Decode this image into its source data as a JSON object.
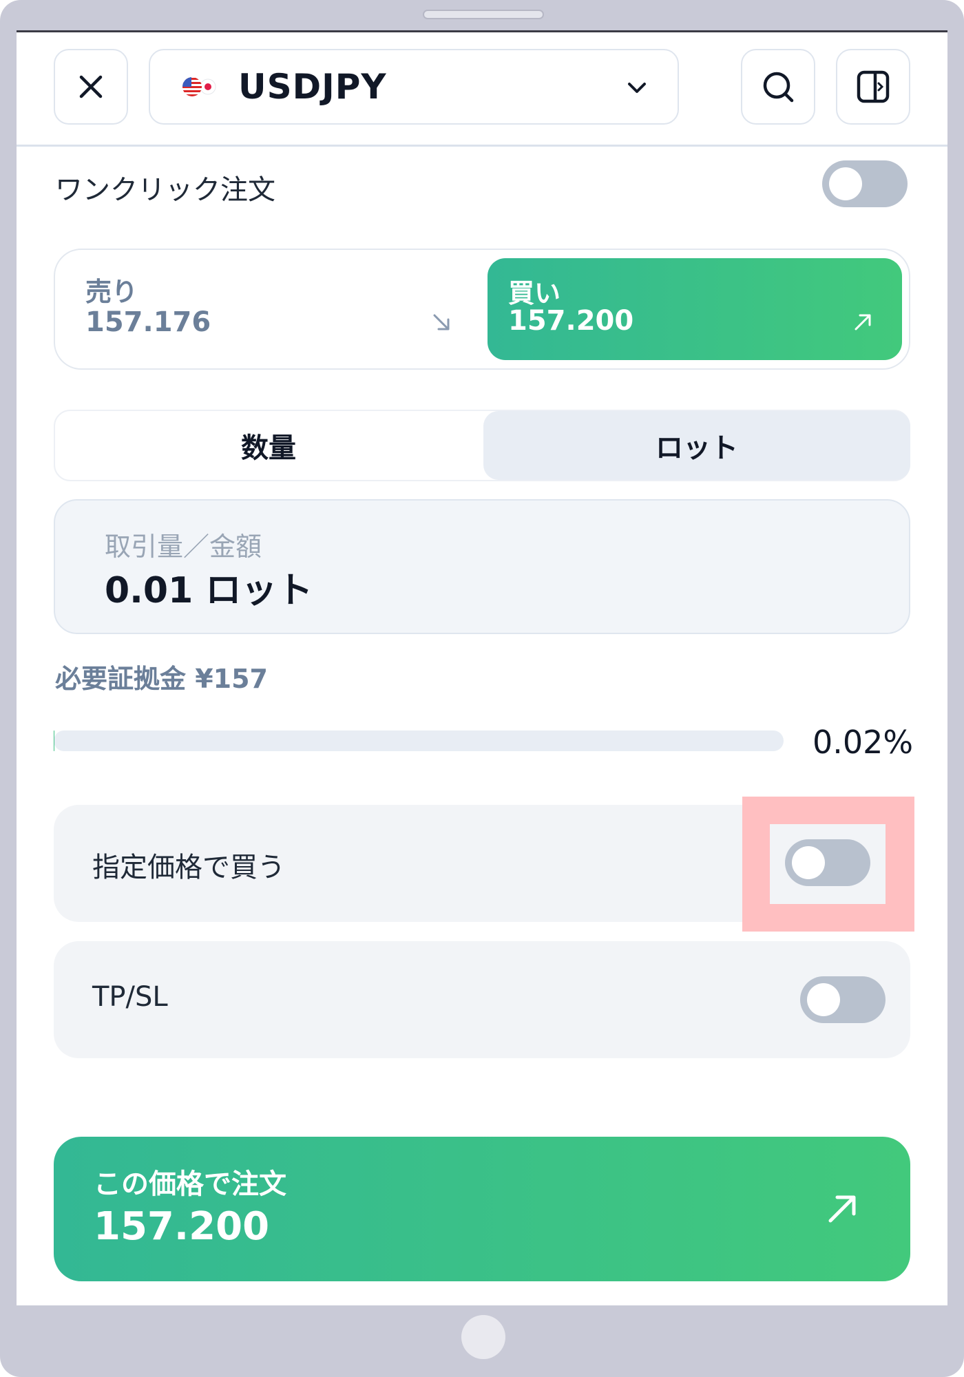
{
  "header": {
    "symbol": "USDJPY",
    "close_icon": "close-icon",
    "search_icon": "search-icon",
    "panel_icon": "side-panel-icon",
    "flag_icon": "us-jp-flag-icon",
    "chevron_icon": "chevron-down-icon"
  },
  "one_click": {
    "label": "ワンクリック注文",
    "enabled": false
  },
  "quote": {
    "sell_label": "売り",
    "sell_price": "157.176",
    "buy_label": "買い",
    "buy_price": "157.200",
    "selected_side": "buy",
    "buy_color": "#3cc28a"
  },
  "unit_tabs": {
    "items": [
      "数量",
      "ロット"
    ],
    "selected": "ロット"
  },
  "amount": {
    "label": "取引量／金額",
    "value": "0.01 ロット"
  },
  "margin": {
    "text": "必要証拠金 ¥157"
  },
  "usage": {
    "percent_text": "0.02%",
    "fraction": 0.0002
  },
  "options": {
    "limit_label": "指定価格で買う",
    "limit_enabled": false,
    "tpsl_label": "TP/SL",
    "tpsl_enabled": false
  },
  "order": {
    "label": "この価格で注文",
    "price": "157.200"
  }
}
